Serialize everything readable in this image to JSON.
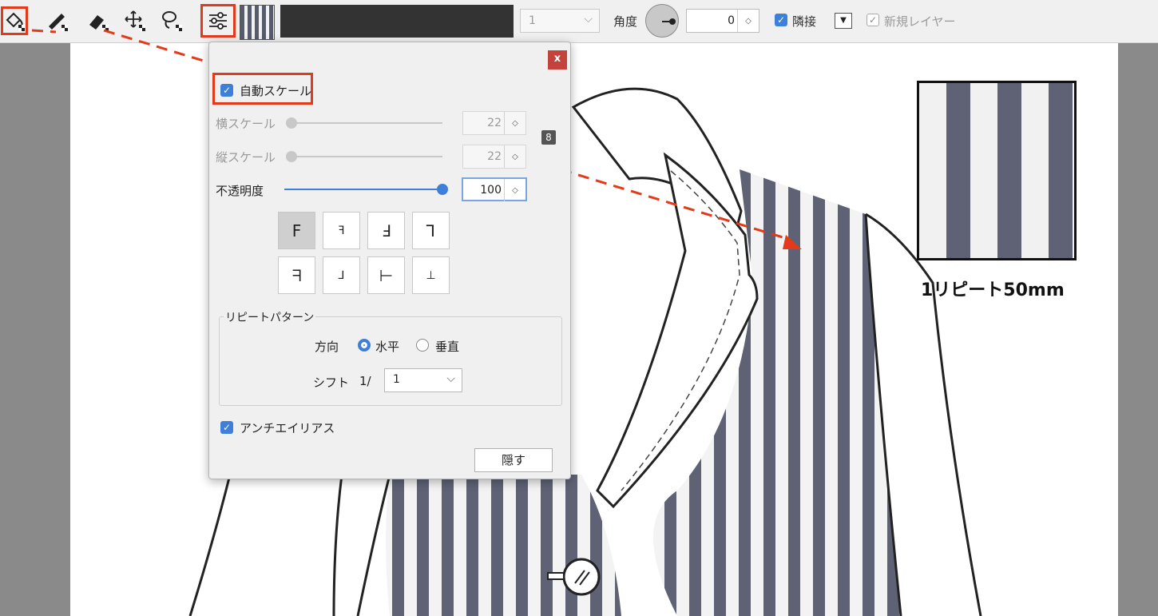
{
  "toolbar": {
    "tools": [
      "fill-bucket-icon",
      "brush-icon",
      "eraser-icon",
      "move-icon",
      "lasso-icon",
      "settings-sliders-icon"
    ],
    "size_value": "1",
    "angle_label": "角度",
    "angle_value": "0",
    "adjacent_label": "隣接",
    "new_layer_label": "新規レイヤー"
  },
  "dialog": {
    "close_label": "x",
    "auto_scale_label": "自動スケール",
    "h_scale_label": "横スケール",
    "h_scale_value": "22",
    "v_scale_label": "縦スケール",
    "v_scale_value": "22",
    "opacity_label": "不透明度",
    "opacity_value": "100",
    "opacity_level": 1.0,
    "flip_buttons": [
      "F",
      "ꟻ",
      "Ⅎ",
      "⅂",
      "ᖷ",
      "⅃",
      "⊢",
      "⊥"
    ],
    "repeat_group_title": "リピートパターン",
    "direction_label": "方向",
    "horizontal_label": "水平",
    "vertical_label": "垂直",
    "shift_label": "シフト",
    "shift_prefix": "1/",
    "shift_value": "1",
    "antialias_label": "アンチエイリアス",
    "hide_label": "隠す"
  },
  "sample": {
    "caption": "1リピート50mm"
  },
  "colors": {
    "highlight": "#e33a1c",
    "stripe_dark": "#5e6274",
    "check_blue": "#3d7fd9"
  }
}
